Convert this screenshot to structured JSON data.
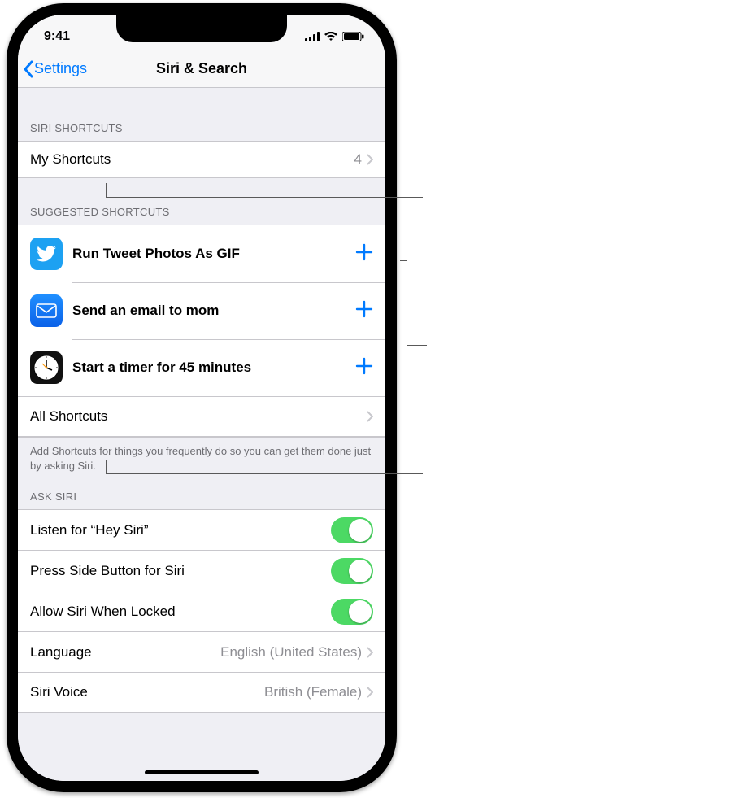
{
  "statusbar": {
    "time": "9:41"
  },
  "navbar": {
    "back": "Settings",
    "title": "Siri & Search"
  },
  "sections": {
    "shortcuts_header": "SIRI SHORTCUTS",
    "my_shortcuts": {
      "label": "My Shortcuts",
      "count": "4"
    },
    "suggested_header": "SUGGESTED SHORTCUTS",
    "suggested": [
      {
        "app": "twitter",
        "label": "Run Tweet Photos As GIF"
      },
      {
        "app": "mail",
        "label": "Send an email to mom"
      },
      {
        "app": "clock",
        "label": "Start a timer for 45 minutes"
      }
    ],
    "all_shortcuts": {
      "label": "All Shortcuts"
    },
    "footer": "Add Shortcuts for things you frequently do so you can get them done just by asking Siri.",
    "ask_header": "ASK SIRI",
    "ask": [
      {
        "label": "Listen for “Hey Siri”",
        "on": true
      },
      {
        "label": "Press Side Button for Siri",
        "on": true
      },
      {
        "label": "Allow Siri When Locked",
        "on": true
      }
    ],
    "language": {
      "label": "Language",
      "value": "English (United States)"
    },
    "voice": {
      "label": "Siri Voice",
      "value": "British (Female)"
    }
  }
}
